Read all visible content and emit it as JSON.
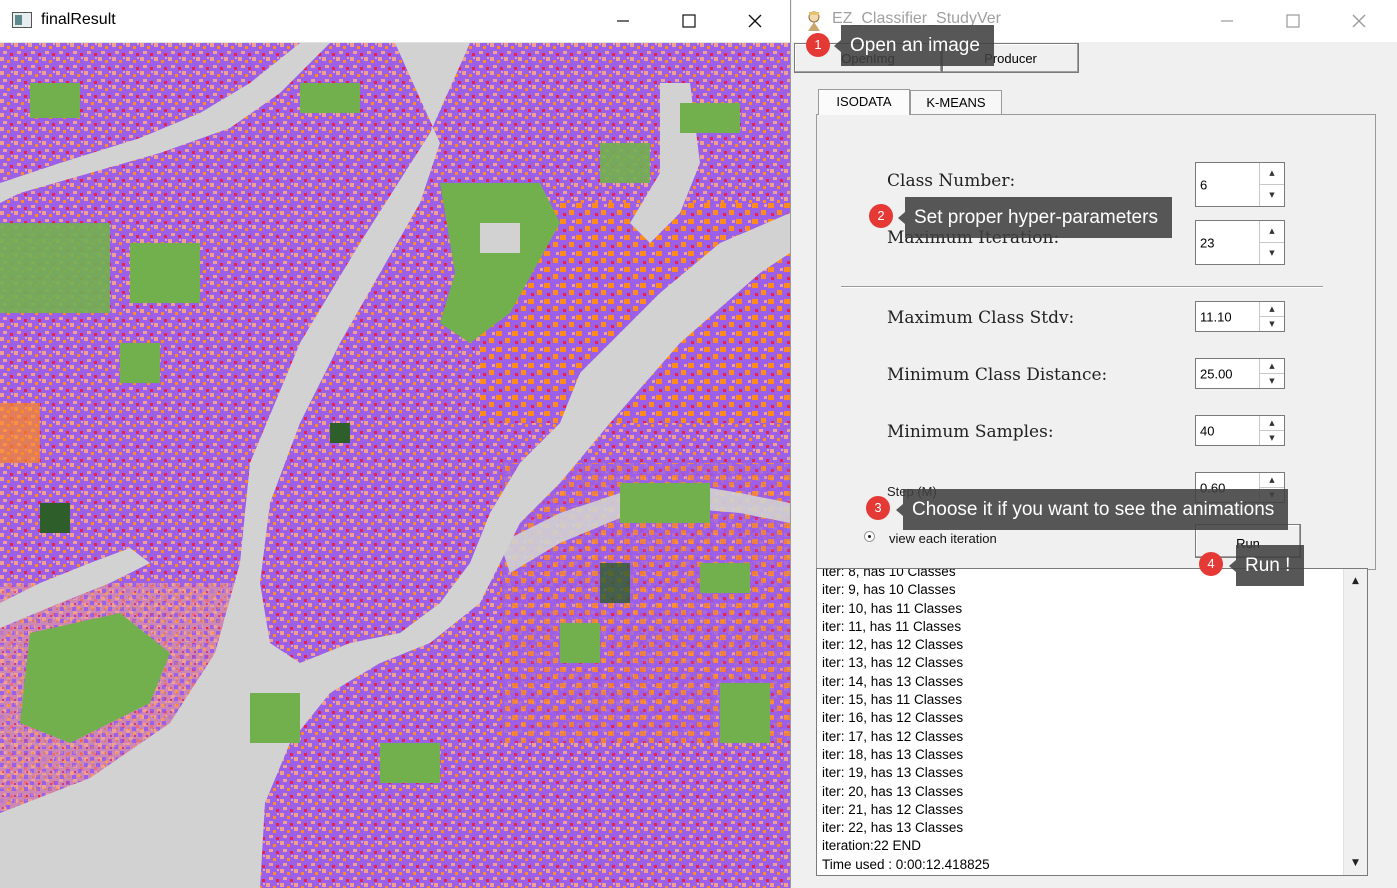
{
  "left_window": {
    "title": "finalResult",
    "controls": {
      "minimize": "minimize",
      "maximize": "maximize",
      "close": "close"
    }
  },
  "right_window": {
    "title": "EZ_Classifier_StudyVer",
    "toolbar": {
      "open_label": "OpenImg",
      "producer_label": "Producer"
    },
    "tabs": [
      {
        "label": "ISODATA",
        "active": true
      },
      {
        "label": "K-MEANS",
        "active": false
      }
    ],
    "params": {
      "class_number": {
        "label": "Class Number:",
        "value": "6"
      },
      "max_iteration": {
        "label": "Maximum Iteration:",
        "value": "23"
      },
      "max_class_stdv": {
        "label": "Maximum Class Stdv:",
        "value": "11.10"
      },
      "min_class_distance": {
        "label": "Minimum Class Distance:",
        "value": "25.00"
      },
      "min_samples": {
        "label": "Minimum Samples:",
        "value": "40"
      },
      "step": {
        "label": "Step (M)",
        "value": "0.60"
      }
    },
    "view_each_iteration_label": "view each iteration",
    "run_label": "Run",
    "log": [
      "iter: 8, has 10 Classes",
      "iter: 9, has 10 Classes",
      "iter: 10, has 11 Classes",
      "iter: 11, has 11 Classes",
      "iter: 12, has 12 Classes",
      "iter: 13, has 12 Classes",
      "iter: 14, has 13 Classes",
      "iter: 15, has 11 Classes",
      "iter: 16, has 12 Classes",
      "iter: 17, has 12 Classes",
      "iter: 18, has 13 Classes",
      "iter: 19, has 13 Classes",
      "iter: 20, has 13 Classes",
      "iter: 21, has 12 Classes",
      "iter: 22, has 13 Classes",
      "iteration:22 END",
      "Time used : 0:00:12.418825"
    ]
  },
  "callouts": [
    {
      "num": "1",
      "text": "Open an image"
    },
    {
      "num": "2",
      "text": "Set proper hyper-parameters"
    },
    {
      "num": "3",
      "text": "Choose it if you want to see the animations"
    },
    {
      "num": "4",
      "text": "Run !"
    }
  ],
  "map_colors": {
    "water": "#d2d2d2",
    "park": "#72b04e",
    "urban_purple": "#9b5fe8",
    "urban_pink": "#f0a090",
    "urban_orange": "#ff8a1e",
    "urban_red": "#e8224a",
    "dark_green": "#2e5e2a"
  },
  "accent": {
    "badge": "#e53936",
    "callout_bg": "#404040"
  }
}
